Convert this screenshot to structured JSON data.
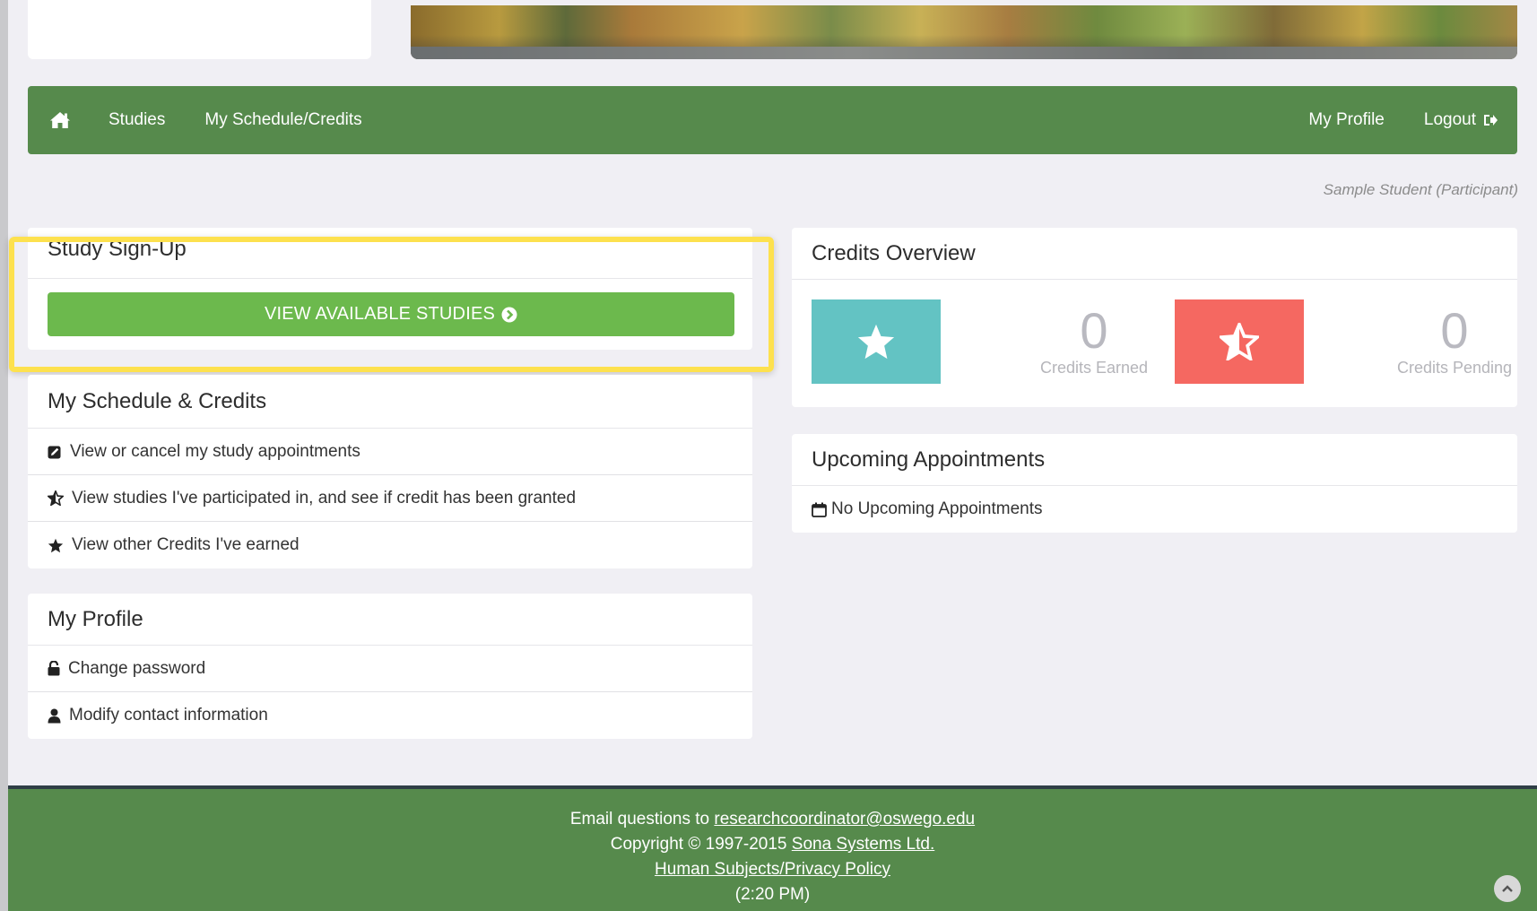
{
  "nav": {
    "home_icon": "home-icon",
    "studies": "Studies",
    "schedule": "My Schedule/Credits",
    "profile": "My Profile",
    "logout": "Logout"
  },
  "user": {
    "label": "Sample Student (Participant)"
  },
  "signup": {
    "title": "Study Sign-Up",
    "button": "VIEW AVAILABLE STUDIES"
  },
  "schedule": {
    "title": "My Schedule & Credits",
    "items": [
      {
        "label": "View or cancel my study appointments",
        "icon": "edit-icon"
      },
      {
        "label": "View studies I've participated in, and see if credit has been granted",
        "icon": "half-star-icon"
      },
      {
        "label": "View other Credits I've earned",
        "icon": "star-icon"
      }
    ]
  },
  "profile": {
    "title": "My Profile",
    "items": [
      {
        "label": "Change password",
        "icon": "unlock-icon"
      },
      {
        "label": "Modify contact information",
        "icon": "user-icon"
      }
    ]
  },
  "credits": {
    "title": "Credits Overview",
    "earned_value": "0",
    "earned_label": "Credits Earned",
    "pending_value": "0",
    "pending_label": "Credits Pending",
    "earned_color": "#63c3c3",
    "pending_color": "#f56861"
  },
  "appointments": {
    "title": "Upcoming Appointments",
    "empty": "No Upcoming Appointments"
  },
  "footer": {
    "email_prefix": "Email questions to",
    "email": "researchcoordinator@oswego.edu",
    "copyright_prefix": "Copyright © 1997-2015",
    "company": "Sona Systems Ltd.",
    "policy": "Human Subjects/Privacy Policy",
    "time": "(2:20 PM)"
  },
  "colors": {
    "nav_green": "#568a4c",
    "button_green": "#6cb94d",
    "highlight": "#fde14e"
  }
}
